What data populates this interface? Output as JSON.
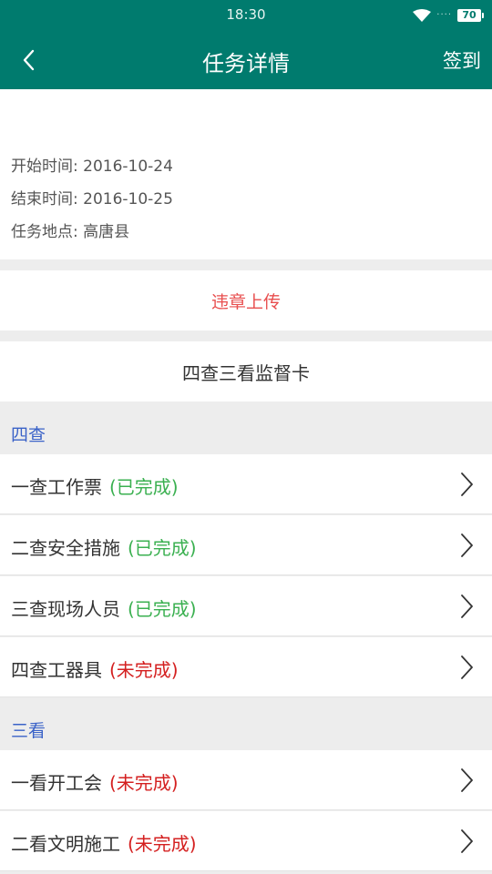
{
  "status_bar": {
    "time": "18:30",
    "signal": "····",
    "battery": "70"
  },
  "header": {
    "title": "任务详情",
    "action": "签到"
  },
  "info": {
    "start": "开始时间: 2016-10-24",
    "end": "结束时间: 2016-10-25",
    "location": "任务地点: 高唐县"
  },
  "upload": {
    "label": "违章上传"
  },
  "card": {
    "title": "四查三看监督卡"
  },
  "sections": [
    {
      "label": "四查",
      "items": [
        {
          "label": "一查工作票",
          "status": "(已完成)"
        },
        {
          "label": "二查安全措施",
          "status": "(已完成)"
        },
        {
          "label": "三查现场人员",
          "status": "(已完成)"
        },
        {
          "label": "四查工器具",
          "status": "(未完成)"
        }
      ]
    },
    {
      "label": "三看",
      "items": [
        {
          "label": "一看开工会",
          "status": "(未完成)"
        },
        {
          "label": "二看文明施工",
          "status": "(未完成)"
        }
      ]
    }
  ],
  "colors": {
    "header": "#007b6e",
    "done": "#3ab050",
    "todo": "#d42020",
    "section": "#3a62c8",
    "upload": "#e84e4e"
  }
}
